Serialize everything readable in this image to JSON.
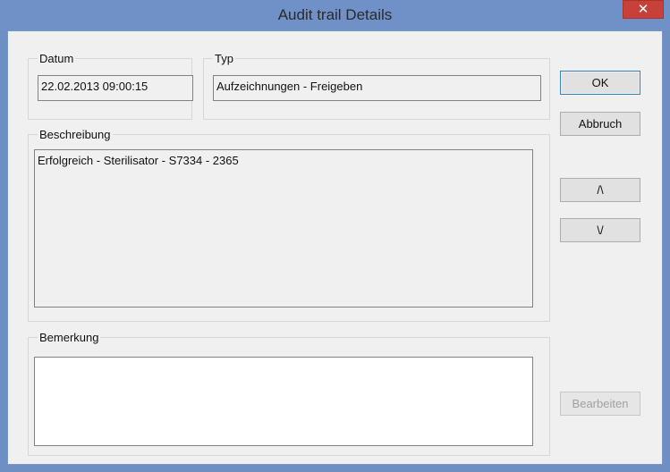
{
  "window": {
    "title": "Audit trail Details",
    "close_glyph": "✕"
  },
  "datum": {
    "label": "Datum",
    "value": "22.02.2013 09:00:15"
  },
  "typ": {
    "label": "Typ",
    "value": "Aufzeichnungen - Freigeben"
  },
  "beschreibung": {
    "label": "Beschreibung",
    "value": "Erfolgreich - Sterilisator - S7334 - 2365"
  },
  "bemerkung": {
    "label": "Bemerkung",
    "value": ""
  },
  "buttons": {
    "ok": "OK",
    "abbruch": "Abbruch",
    "up": "/\\",
    "down": "\\/",
    "bearbeiten": "Bearbeiten"
  },
  "colors": {
    "titlebar": "#6f91c8",
    "close": "#c7413a",
    "client": "#f0f0f0"
  },
  "icons": {
    "close": "close-icon"
  }
}
